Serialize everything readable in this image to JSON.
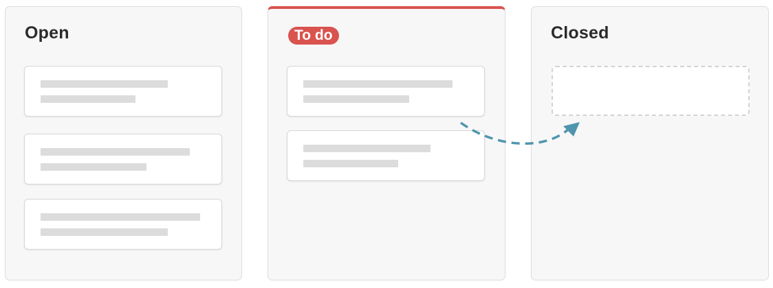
{
  "columns": {
    "open": {
      "title": "Open"
    },
    "todo": {
      "title": "To do",
      "accent_color": "#d9534f"
    },
    "closed": {
      "title": "Closed"
    }
  },
  "arrow": {
    "color": "#4f95ad",
    "style": "dashed"
  }
}
